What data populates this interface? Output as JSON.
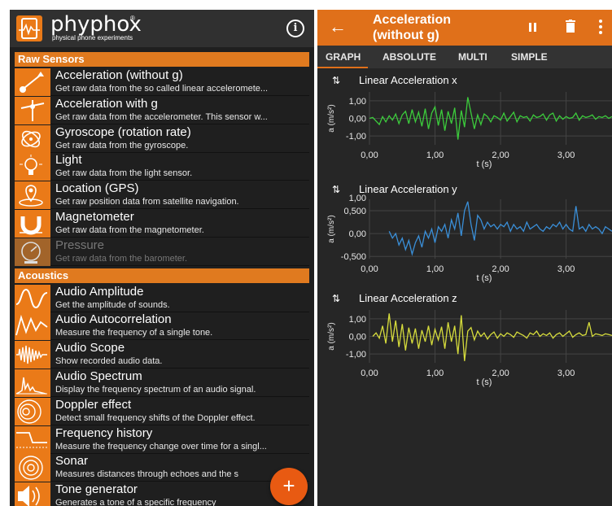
{
  "app": {
    "logo_text": "phyphox",
    "logo_reg": "®",
    "logo_subtitle": "physical phone experiments",
    "info_icon": "info-icon"
  },
  "sections": [
    {
      "label": "Raw Sensors",
      "items": [
        {
          "title": "Acceleration (without g)",
          "desc": "Get raw data from the so called linear acceleromete...",
          "icon": "acceleration-icon",
          "enabled": true
        },
        {
          "title": "Acceleration with g",
          "desc": "Get raw data from the accelerometer. This sensor w...",
          "icon": "acceleration-g-icon",
          "enabled": true
        },
        {
          "title": "Gyroscope (rotation rate)",
          "desc": "Get raw data from the gyroscope.",
          "icon": "gyroscope-icon",
          "enabled": true
        },
        {
          "title": "Light",
          "desc": "Get raw data from the light sensor.",
          "icon": "light-bulb-icon",
          "enabled": true
        },
        {
          "title": "Location (GPS)",
          "desc": "Get raw position data from satellite navigation.",
          "icon": "location-icon",
          "enabled": true
        },
        {
          "title": "Magnetometer",
          "desc": "Get raw data from the magnetometer.",
          "icon": "magnet-icon",
          "enabled": true
        },
        {
          "title": "Pressure",
          "desc": "Get raw data from the barometer.",
          "icon": "pressure-gauge-icon",
          "enabled": false
        }
      ]
    },
    {
      "label": "Acoustics",
      "items": [
        {
          "title": "Audio Amplitude",
          "desc": "Get the amplitude of sounds.",
          "icon": "audio-amplitude-icon",
          "enabled": true
        },
        {
          "title": "Audio Autocorrelation",
          "desc": "Measure the frequency of a single tone.",
          "icon": "audio-autocorrelation-icon",
          "enabled": true
        },
        {
          "title": "Audio Scope",
          "desc": "Show recorded audio data.",
          "icon": "audio-scope-icon",
          "enabled": true
        },
        {
          "title": "Audio Spectrum",
          "desc": "Display the frequency spectrum of an audio signal.",
          "icon": "audio-spectrum-icon",
          "enabled": true
        },
        {
          "title": "Doppler effect",
          "desc": "Detect small frequency shifts of the Doppler effect.",
          "icon": "doppler-icon",
          "enabled": true
        },
        {
          "title": "Frequency history",
          "desc": "Measure the frequency change over time for a singl...",
          "icon": "frequency-history-icon",
          "enabled": true
        },
        {
          "title": "Sonar",
          "desc": "Measures distances through echoes and the s",
          "icon": "sonar-icon",
          "enabled": true
        },
        {
          "title": "Tone generator",
          "desc": "Generates a tone of a specific frequency",
          "icon": "tone-generator-icon",
          "enabled": true
        }
      ]
    }
  ],
  "fab": {
    "label": "+",
    "icon": "plus-icon"
  },
  "experiment": {
    "title": "Acceleration (without g)",
    "back_icon": "back-arrow-icon",
    "pause_icon": "pause-icon",
    "delete_icon": "trash-icon",
    "more_icon": "more-vert-icon",
    "tabs": [
      {
        "label": "GRAPH",
        "active": true
      },
      {
        "label": "ABSOLUTE",
        "active": false
      },
      {
        "label": "MULTI",
        "active": false
      },
      {
        "label": "SIMPLE",
        "active": false
      }
    ]
  },
  "chart_data": [
    {
      "type": "line",
      "title": "Linear Acceleration x",
      "xlabel": "t (s)",
      "ylabel": "a (m/s²)",
      "color": "#3ccc3c",
      "xlim": [
        0,
        3.7
      ],
      "ylim": [
        -1.5,
        1.5
      ],
      "xticks": [
        "0,00",
        "1,00",
        "2,00",
        "3,00"
      ],
      "yticks": [
        "1,00",
        "0,00",
        "-1,00"
      ],
      "yticks_values": [
        1,
        0,
        -1
      ],
      "x": [
        0.0,
        0.05,
        0.1,
        0.15,
        0.2,
        0.25,
        0.3,
        0.35,
        0.4,
        0.45,
        0.5,
        0.55,
        0.6,
        0.65,
        0.7,
        0.75,
        0.8,
        0.85,
        0.9,
        0.95,
        1.0,
        1.05,
        1.1,
        1.15,
        1.2,
        1.25,
        1.3,
        1.35,
        1.4,
        1.45,
        1.5,
        1.55,
        1.6,
        1.65,
        1.7,
        1.75,
        1.8,
        1.85,
        1.9,
        1.95,
        2.0,
        2.05,
        2.1,
        2.15,
        2.2,
        2.25,
        2.3,
        2.35,
        2.4,
        2.45,
        2.5,
        2.55,
        2.6,
        2.65,
        2.7,
        2.75,
        2.8,
        2.85,
        2.9,
        2.95,
        3.0,
        3.05,
        3.1,
        3.15,
        3.2,
        3.25,
        3.3,
        3.35,
        3.4,
        3.45,
        3.5,
        3.55,
        3.6,
        3.65,
        3.7
      ],
      "values": [
        0.0,
        0.05,
        -0.15,
        -0.35,
        0.1,
        -0.2,
        0.15,
        -0.1,
        0.25,
        -0.3,
        0.2,
        0.4,
        -0.3,
        0.5,
        -0.2,
        0.35,
        -0.45,
        0.55,
        -0.6,
        0.3,
        0.65,
        -0.4,
        0.5,
        -0.7,
        0.4,
        -0.3,
        0.6,
        -1.2,
        0.45,
        -0.5,
        1.2,
        0.3,
        -0.6,
        0.2,
        -0.35,
        0.25,
        0.1,
        -0.2,
        0.15,
        0.05,
        -0.1,
        0.3,
        -0.15,
        0.1,
        0.35,
        -0.2,
        0.15,
        0.05,
        0.1,
        -0.15,
        0.2,
        0.05,
        0.1,
        0.25,
        -0.1,
        0.2,
        0.3,
        -0.15,
        0.15,
        -0.05,
        0.1,
        0.0,
        0.05,
        0.3,
        -0.1,
        0.15,
        0.05,
        0.1,
        0.2,
        -0.05,
        0.1,
        0.05,
        0.15,
        0.0,
        0.1
      ]
    },
    {
      "type": "line",
      "title": "Linear Acceleration y",
      "xlabel": "t (s)",
      "ylabel": "a (m/s²)",
      "color": "#3a8fd8",
      "xlim": [
        0,
        3.7
      ],
      "ylim": [
        -0.55,
        0.75
      ],
      "xticks": [
        "0,00",
        "1,00",
        "2,00",
        "3,00"
      ],
      "yticks": [
        "1,00",
        "0,500",
        "0,00",
        "-0,500"
      ],
      "yticks_values": [
        0.9,
        0.5,
        0,
        -0.5
      ],
      "x": [
        0.3,
        0.35,
        0.4,
        0.45,
        0.5,
        0.55,
        0.6,
        0.65,
        0.7,
        0.75,
        0.8,
        0.85,
        0.9,
        0.95,
        1.0,
        1.05,
        1.1,
        1.15,
        1.2,
        1.25,
        1.3,
        1.35,
        1.4,
        1.45,
        1.5,
        1.55,
        1.6,
        1.65,
        1.7,
        1.75,
        1.8,
        1.85,
        1.9,
        1.95,
        2.0,
        2.05,
        2.1,
        2.15,
        2.2,
        2.25,
        2.3,
        2.35,
        2.4,
        2.45,
        2.5,
        2.55,
        2.6,
        2.65,
        2.7,
        2.75,
        2.8,
        2.85,
        2.9,
        2.95,
        3.0,
        3.05,
        3.1,
        3.15,
        3.2,
        3.25,
        3.3,
        3.35,
        3.4,
        3.45,
        3.5,
        3.55,
        3.6,
        3.65,
        3.7
      ],
      "values": [
        0.05,
        -0.1,
        0.0,
        -0.25,
        -0.1,
        -0.35,
        -0.15,
        -0.45,
        -0.2,
        -0.05,
        -0.3,
        0.05,
        -0.1,
        0.1,
        -0.2,
        0.15,
        0.05,
        0.2,
        -0.1,
        0.3,
        0.1,
        0.45,
        -0.05,
        0.5,
        0.7,
        0.2,
        -0.15,
        0.4,
        0.3,
        0.1,
        0.25,
        0.15,
        0.2,
        0.1,
        0.2,
        0.15,
        0.25,
        0.05,
        0.2,
        0.1,
        0.15,
        0.05,
        0.25,
        0.1,
        0.15,
        0.2,
        0.1,
        0.05,
        0.15,
        0.1,
        0.2,
        0.15,
        0.25,
        0.1,
        0.2,
        0.1,
        0.05,
        0.6,
        0.1,
        0.15,
        0.05,
        0.2,
        0.1,
        0.15,
        0.1,
        0.0,
        0.15,
        0.1,
        0.05
      ]
    },
    {
      "type": "line",
      "title": "Linear Acceleration z",
      "xlabel": "t (s)",
      "ylabel": "a (m/s²)",
      "color": "#d6dc3c",
      "xlim": [
        0,
        3.7
      ],
      "ylim": [
        -1.5,
        1.5
      ],
      "xticks": [
        "0,00",
        "1,00",
        "2,00",
        "3,00"
      ],
      "yticks": [
        "1,00",
        "0,00",
        "-1,00"
      ],
      "yticks_values": [
        1,
        0,
        -1
      ],
      "x": [
        0.05,
        0.1,
        0.15,
        0.2,
        0.25,
        0.3,
        0.35,
        0.4,
        0.45,
        0.5,
        0.55,
        0.6,
        0.65,
        0.7,
        0.75,
        0.8,
        0.85,
        0.9,
        0.95,
        1.0,
        1.05,
        1.1,
        1.15,
        1.2,
        1.25,
        1.3,
        1.35,
        1.4,
        1.45,
        1.5,
        1.55,
        1.6,
        1.65,
        1.7,
        1.75,
        1.8,
        1.85,
        1.9,
        1.95,
        2.0,
        2.05,
        2.1,
        2.15,
        2.2,
        2.25,
        2.3,
        2.35,
        2.4,
        2.45,
        2.5,
        2.55,
        2.6,
        2.65,
        2.7,
        2.75,
        2.8,
        2.85,
        2.9,
        2.95,
        3.0,
        3.05,
        3.1,
        3.15,
        3.2,
        3.25,
        3.3,
        3.35,
        3.4,
        3.45,
        3.5,
        3.55,
        3.6,
        3.65,
        3.7
      ],
      "values": [
        0.0,
        0.2,
        -0.1,
        0.6,
        -0.4,
        1.3,
        -0.3,
        0.9,
        -0.6,
        0.7,
        -0.8,
        0.5,
        -0.4,
        0.45,
        -0.7,
        0.35,
        -0.3,
        0.6,
        -0.5,
        0.4,
        -0.2,
        0.55,
        -0.7,
        0.8,
        -0.3,
        0.6,
        -1.0,
        1.2,
        -1.4,
        0.3,
        0.5,
        -0.2,
        0.3,
        0.0,
        0.2,
        -0.15,
        0.1,
        0.25,
        -0.1,
        0.15,
        0.0,
        0.2,
        0.1,
        -0.05,
        0.25,
        0.15,
        0.05,
        -0.1,
        0.2,
        0.1,
        0.3,
        0.0,
        0.15,
        0.05,
        0.2,
        -0.1,
        0.1,
        0.2,
        0.0,
        0.15,
        0.3,
        -0.05,
        0.1,
        0.2,
        0.05,
        0.1,
        0.8,
        0.0,
        0.15,
        0.1,
        0.05,
        0.15,
        0.1,
        0.05
      ]
    }
  ]
}
